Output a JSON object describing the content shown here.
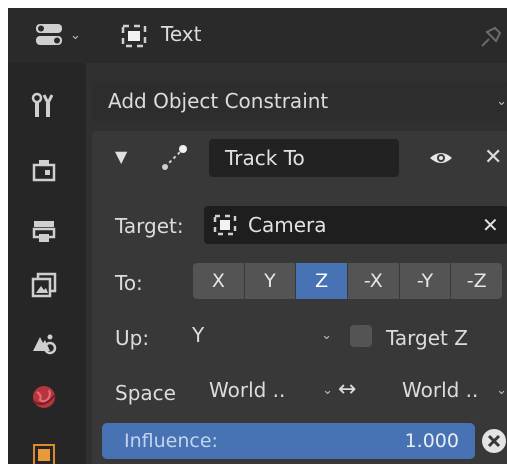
{
  "header": {
    "editor_icon": "editor-type-icon",
    "object_name": "Text"
  },
  "sidebar": {
    "tabs": [
      {
        "name": "tool-icon",
        "glyph": "🔧"
      },
      {
        "name": "render-icon",
        "glyph": "▣"
      },
      {
        "name": "output-icon",
        "glyph": "🖨"
      },
      {
        "name": "view-layer-icon",
        "glyph": "▧"
      },
      {
        "name": "scene-icon",
        "glyph": "⚙"
      },
      {
        "name": "world-icon",
        "glyph": "●"
      },
      {
        "name": "object-icon",
        "glyph": "■"
      }
    ]
  },
  "constraint_menu": {
    "add_label": "Add Object Constraint"
  },
  "constraint": {
    "name": "Track To",
    "target_label": "Target:",
    "target_value": "Camera",
    "to_label": "To:",
    "to_axes": [
      "X",
      "Y",
      "Z",
      "-X",
      "-Y",
      "-Z"
    ],
    "to_selected": "Z",
    "up_label": "Up:",
    "up_value": "Y",
    "target_z_label": "Target Z",
    "space_label": "Space",
    "space_owner": "World ..",
    "space_arrow": "↔",
    "space_target": "World ..",
    "influence_label": "Influence:",
    "influence_value": "1.000",
    "influence_fraction": 1.0
  },
  "colors": {
    "accent": "#4772b3",
    "background": "#303030"
  }
}
